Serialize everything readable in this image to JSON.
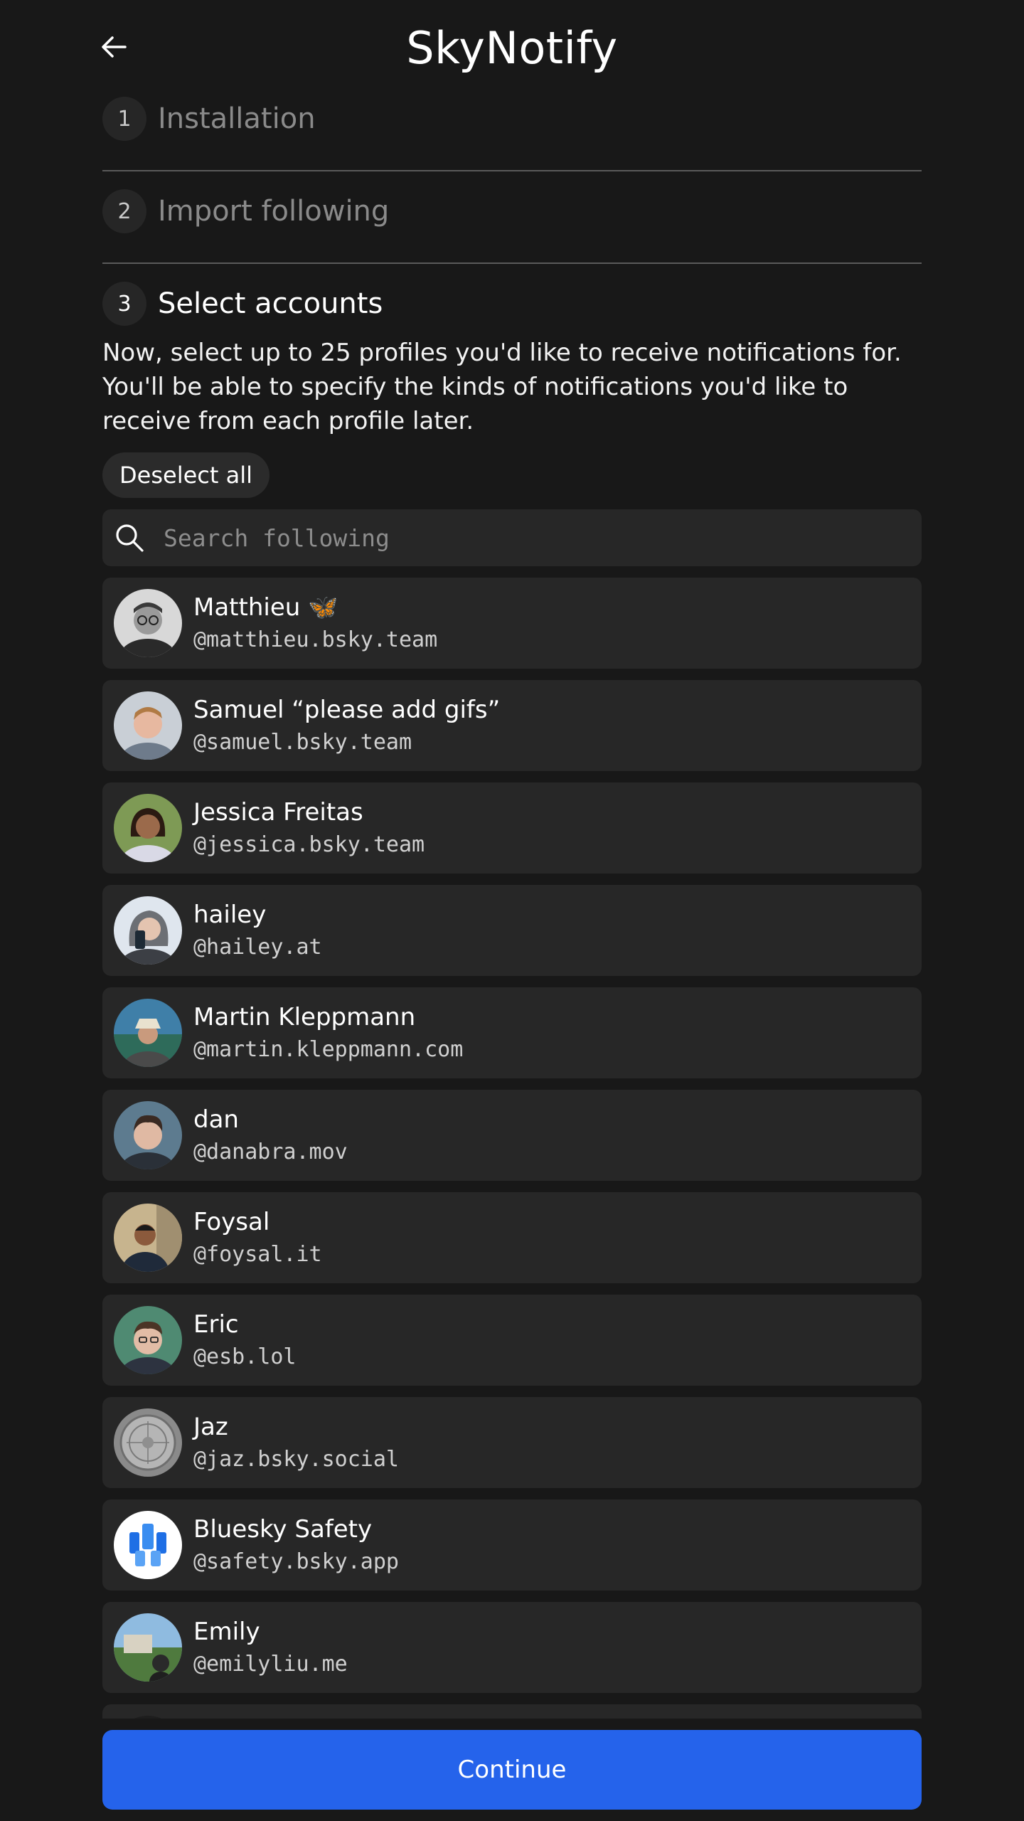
{
  "header": {
    "title": "SkyNotify",
    "back_icon": "arrow-left-icon"
  },
  "steps": [
    {
      "number": "1",
      "title": "Installation",
      "state": "completed"
    },
    {
      "number": "2",
      "title": "Import following",
      "state": "completed"
    },
    {
      "number": "3",
      "title": "Select accounts",
      "state": "active"
    }
  ],
  "select_accounts": {
    "description": "Now, select up to 25 profiles you'd like to receive notifications for. You'll be able to specify the kinds of notifications you'd like to receive from each profile later.",
    "deselect_all_label": "Deselect all",
    "search_placeholder": "Search following",
    "search_icon": "search-icon"
  },
  "accounts": [
    {
      "name": "Matthieu 🦋",
      "handle": "@matthieu.bsky.team"
    },
    {
      "name": "Samuel “please add gifs”",
      "handle": "@samuel.bsky.team"
    },
    {
      "name": "Jessica Freitas",
      "handle": "@jessica.bsky.team"
    },
    {
      "name": "hailey",
      "handle": "@hailey.at"
    },
    {
      "name": "Martin Kleppmann",
      "handle": "@martin.kleppmann.com"
    },
    {
      "name": "dan",
      "handle": "@danabra.mov"
    },
    {
      "name": "Foysal",
      "handle": "@foysal.it"
    },
    {
      "name": "Eric",
      "handle": "@esb.lol"
    },
    {
      "name": "Jaz",
      "handle": "@jaz.bsky.social"
    },
    {
      "name": "Bluesky Safety",
      "handle": "@safety.bsky.app"
    },
    {
      "name": "Emily",
      "handle": "@emilyliu.me"
    }
  ],
  "footer": {
    "continue_label": "Continue"
  },
  "colors": {
    "background": "#181818",
    "card": "#272727",
    "accent": "#2563eb"
  }
}
